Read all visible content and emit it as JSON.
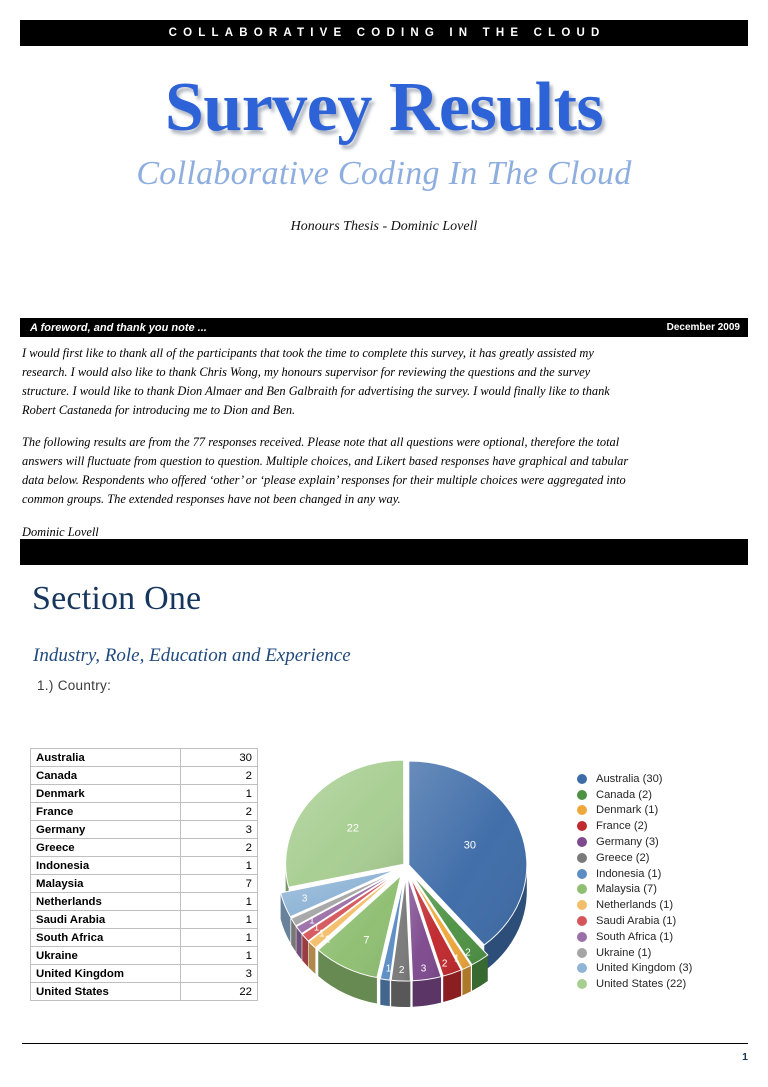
{
  "header": {
    "banner_text": "COLLABORATIVE CODING IN THE CLOUD"
  },
  "title": {
    "main": "Survey Results",
    "subtitle": "Collaborative Coding In The Cloud",
    "byline": "Honours Thesis -  Dominic Lovell"
  },
  "foreword": {
    "bar_title": "A foreword, and thank you note ...",
    "bar_date": "December 2009",
    "paragraph_1": "I would first like to thank all of the participants that took the time to complete this survey, it has greatly assisted my research. I would also like to thank Chris Wong, my honours supervisor for reviewing the questions and the survey structure. I would like to thank Dion Almaer and Ben Galbraith for advertising the survey. I would finally like to thank Robert Castaneda for introducing me to Dion and Ben.",
    "paragraph_2": "The following results are from the 77 responses received. Please note that all questions were optional, therefore the total answers will fluctuate from question to question.  Multiple choices, and Likert based responses have graphical and tabular data below. Respondents who offered ‘other’ or ‘please explain’ responses for their multiple choices were aggregated into common groups. The extended responses have not been changed in any way.",
    "signature": "Dominic Lovell"
  },
  "section": {
    "title": "Section One",
    "subtitle": "Industry, Role, Education and Experience",
    "question": "1.) Country:"
  },
  "chart_data": {
    "type": "pie",
    "title": "1.) Country:",
    "legend_position": "right",
    "three_d": true,
    "categories": [
      "Australia",
      "Canada",
      "Denmark",
      "France",
      "Germany",
      "Greece",
      "Indonesia",
      "Malaysia",
      "Netherlands",
      "Saudi Arabia",
      "South Africa",
      "Ukraine",
      "United Kingdom",
      "United States"
    ],
    "values": [
      30,
      2,
      1,
      2,
      3,
      2,
      1,
      7,
      1,
      1,
      1,
      1,
      3,
      22
    ],
    "total": 77,
    "colors": [
      "#3E6CA8",
      "#4E9244",
      "#EFA83C",
      "#C0292E",
      "#7E4A8E",
      "#7A7A7A",
      "#5C8EC4",
      "#8FBF72",
      "#F3BE6A",
      "#D4565B",
      "#9B6FA8",
      "#A5A5A5",
      "#8FB4D6",
      "#A8CE92"
    ],
    "slice_labels": [
      "30",
      "2",
      "1",
      "2",
      "3",
      "2",
      "1",
      "7",
      "1",
      "1",
      "1",
      "1",
      "3",
      "22"
    ],
    "legend_entries": [
      "Australia (30)",
      "Canada (2)",
      "Denmark (1)",
      "France (2)",
      "Germany (3)",
      "Greece (2)",
      "Indonesia (1)",
      "Malaysia (7)",
      "Netherlands (1)",
      "Saudi Arabia (1)",
      "South Africa (1)",
      "Ukraine (1)",
      "United Kingdom (3)",
      "United States (22)"
    ]
  },
  "table": {
    "rows": [
      {
        "name": "Australia",
        "count": "30"
      },
      {
        "name": "Canada",
        "count": "2"
      },
      {
        "name": "Denmark",
        "count": "1"
      },
      {
        "name": "France",
        "count": "2"
      },
      {
        "name": "Germany",
        "count": "3"
      },
      {
        "name": "Greece",
        "count": "2"
      },
      {
        "name": "Indonesia",
        "count": "1"
      },
      {
        "name": "Malaysia",
        "count": "7"
      },
      {
        "name": "Netherlands",
        "count": "1"
      },
      {
        "name": "Saudi Arabia",
        "count": "1"
      },
      {
        "name": "South Africa",
        "count": "1"
      },
      {
        "name": "Ukraine",
        "count": "1"
      },
      {
        "name": "United Kingdom",
        "count": "3"
      },
      {
        "name": "United States",
        "count": "22"
      }
    ]
  },
  "footer": {
    "page_number": "1"
  }
}
